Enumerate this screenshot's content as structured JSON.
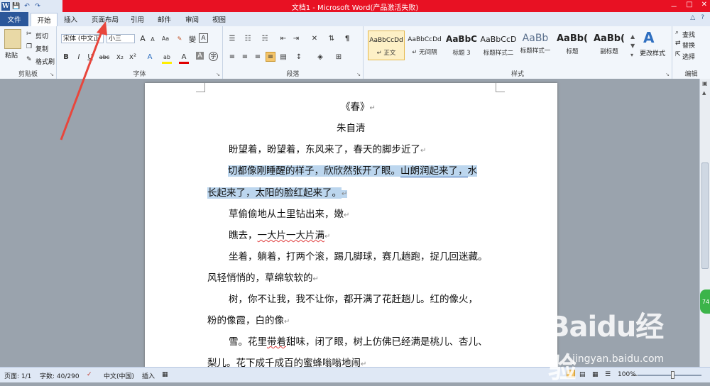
{
  "window": {
    "title": "文档1 - Microsoft Word(产品激活失败)",
    "controls": [
      "－",
      "□",
      "✕"
    ]
  },
  "qat": {
    "word": "W",
    "save": "💾",
    "undo": "↶",
    "redo": "↷"
  },
  "tabs": [
    "文件",
    "开始",
    "插入",
    "页面布局",
    "引用",
    "邮件",
    "审阅",
    "视图"
  ],
  "tab_right": [
    "△",
    "?"
  ],
  "ribbon": {
    "clipboard": {
      "label": "剪贴板",
      "paste": "粘贴",
      "cut": "剪切",
      "copy": "复制",
      "format_painter": "格式刷"
    },
    "font": {
      "label": "字体",
      "font_name": "宋体 (中文正",
      "font_size": "小三",
      "grow": "A",
      "shrink": "A",
      "clear": "Aa",
      "wen": "變",
      "aletter": "A",
      "bold": "B",
      "italic": "I",
      "underline": "U",
      "strike": "abc",
      "sub": "x₂",
      "sup": "x²",
      "effect": "A",
      "highlight": "ab",
      "color": "A",
      "charshade": "A",
      "enclose": "字"
    },
    "paragraph": {
      "label": "段落"
    },
    "styles": {
      "label": "样式",
      "items": [
        {
          "sample": "AaBbCcDd",
          "name": "↵ 正文"
        },
        {
          "sample": "AaBbCcDd",
          "name": "↵ 无间隔"
        },
        {
          "sample": "AaBbC",
          "name": "标题 3"
        },
        {
          "sample": "AaBbCcD",
          "name": "标题样式二"
        },
        {
          "sample": "AaBb",
          "name": "标题样式一"
        },
        {
          "sample": "AaBb(",
          "name": "标题"
        },
        {
          "sample": "AaBb(",
          "name": "副标题"
        }
      ],
      "change_styles": "更改样式"
    },
    "editing": {
      "label": "编辑",
      "find": "查找",
      "replace": "替换",
      "select": "选择"
    }
  },
  "document": {
    "title": "《春》",
    "author": "朱自清",
    "p1": "盼望着，盼望着，东风来了，春天的脚步近了",
    "p2_a": "切都像刚睡醒的样子，欣欣然张开了眼。",
    "p2_b": "山朗润起来了，",
    "p2_c": "水",
    "p2_d": "长起来了，太阳的脸红起来了。",
    "p3": "草偷偷地从土里钻出来，嫩",
    "p4_a": "瞧去，",
    "p4_b": "一大片一大片满",
    "p5_a": "坐着，躺着，打两个滚，踢几脚球，赛几趟跑，捉几回迷藏。",
    "p5_b": "风轻悄悄的，草绵软软的",
    "p6_a": "树，你不让我，我不让你，都开满了花赶趟儿。红的像火，",
    "p6_b": "粉的像霞，白的像",
    "p7_a": "雪。花里",
    "p7_b": "带着",
    "p7_c": "甜味，闭了眼，树上仿佛已经满是桃儿、杏儿、",
    "p8": "梨儿。花下成千成百的蜜蜂嗡嗡地闹",
    "para_mark": "↵"
  },
  "status": {
    "page": "页面: 1/1",
    "words": "字数: 40/290",
    "lang": "中文(中国)",
    "mode": "插入",
    "zoom": "100%",
    "zoom_minus": "－",
    "zoom_plus": "+"
  },
  "watermark": {
    "logo": "Baidu经验",
    "url": "jingyan.baidu.com"
  },
  "side_badge": "74"
}
